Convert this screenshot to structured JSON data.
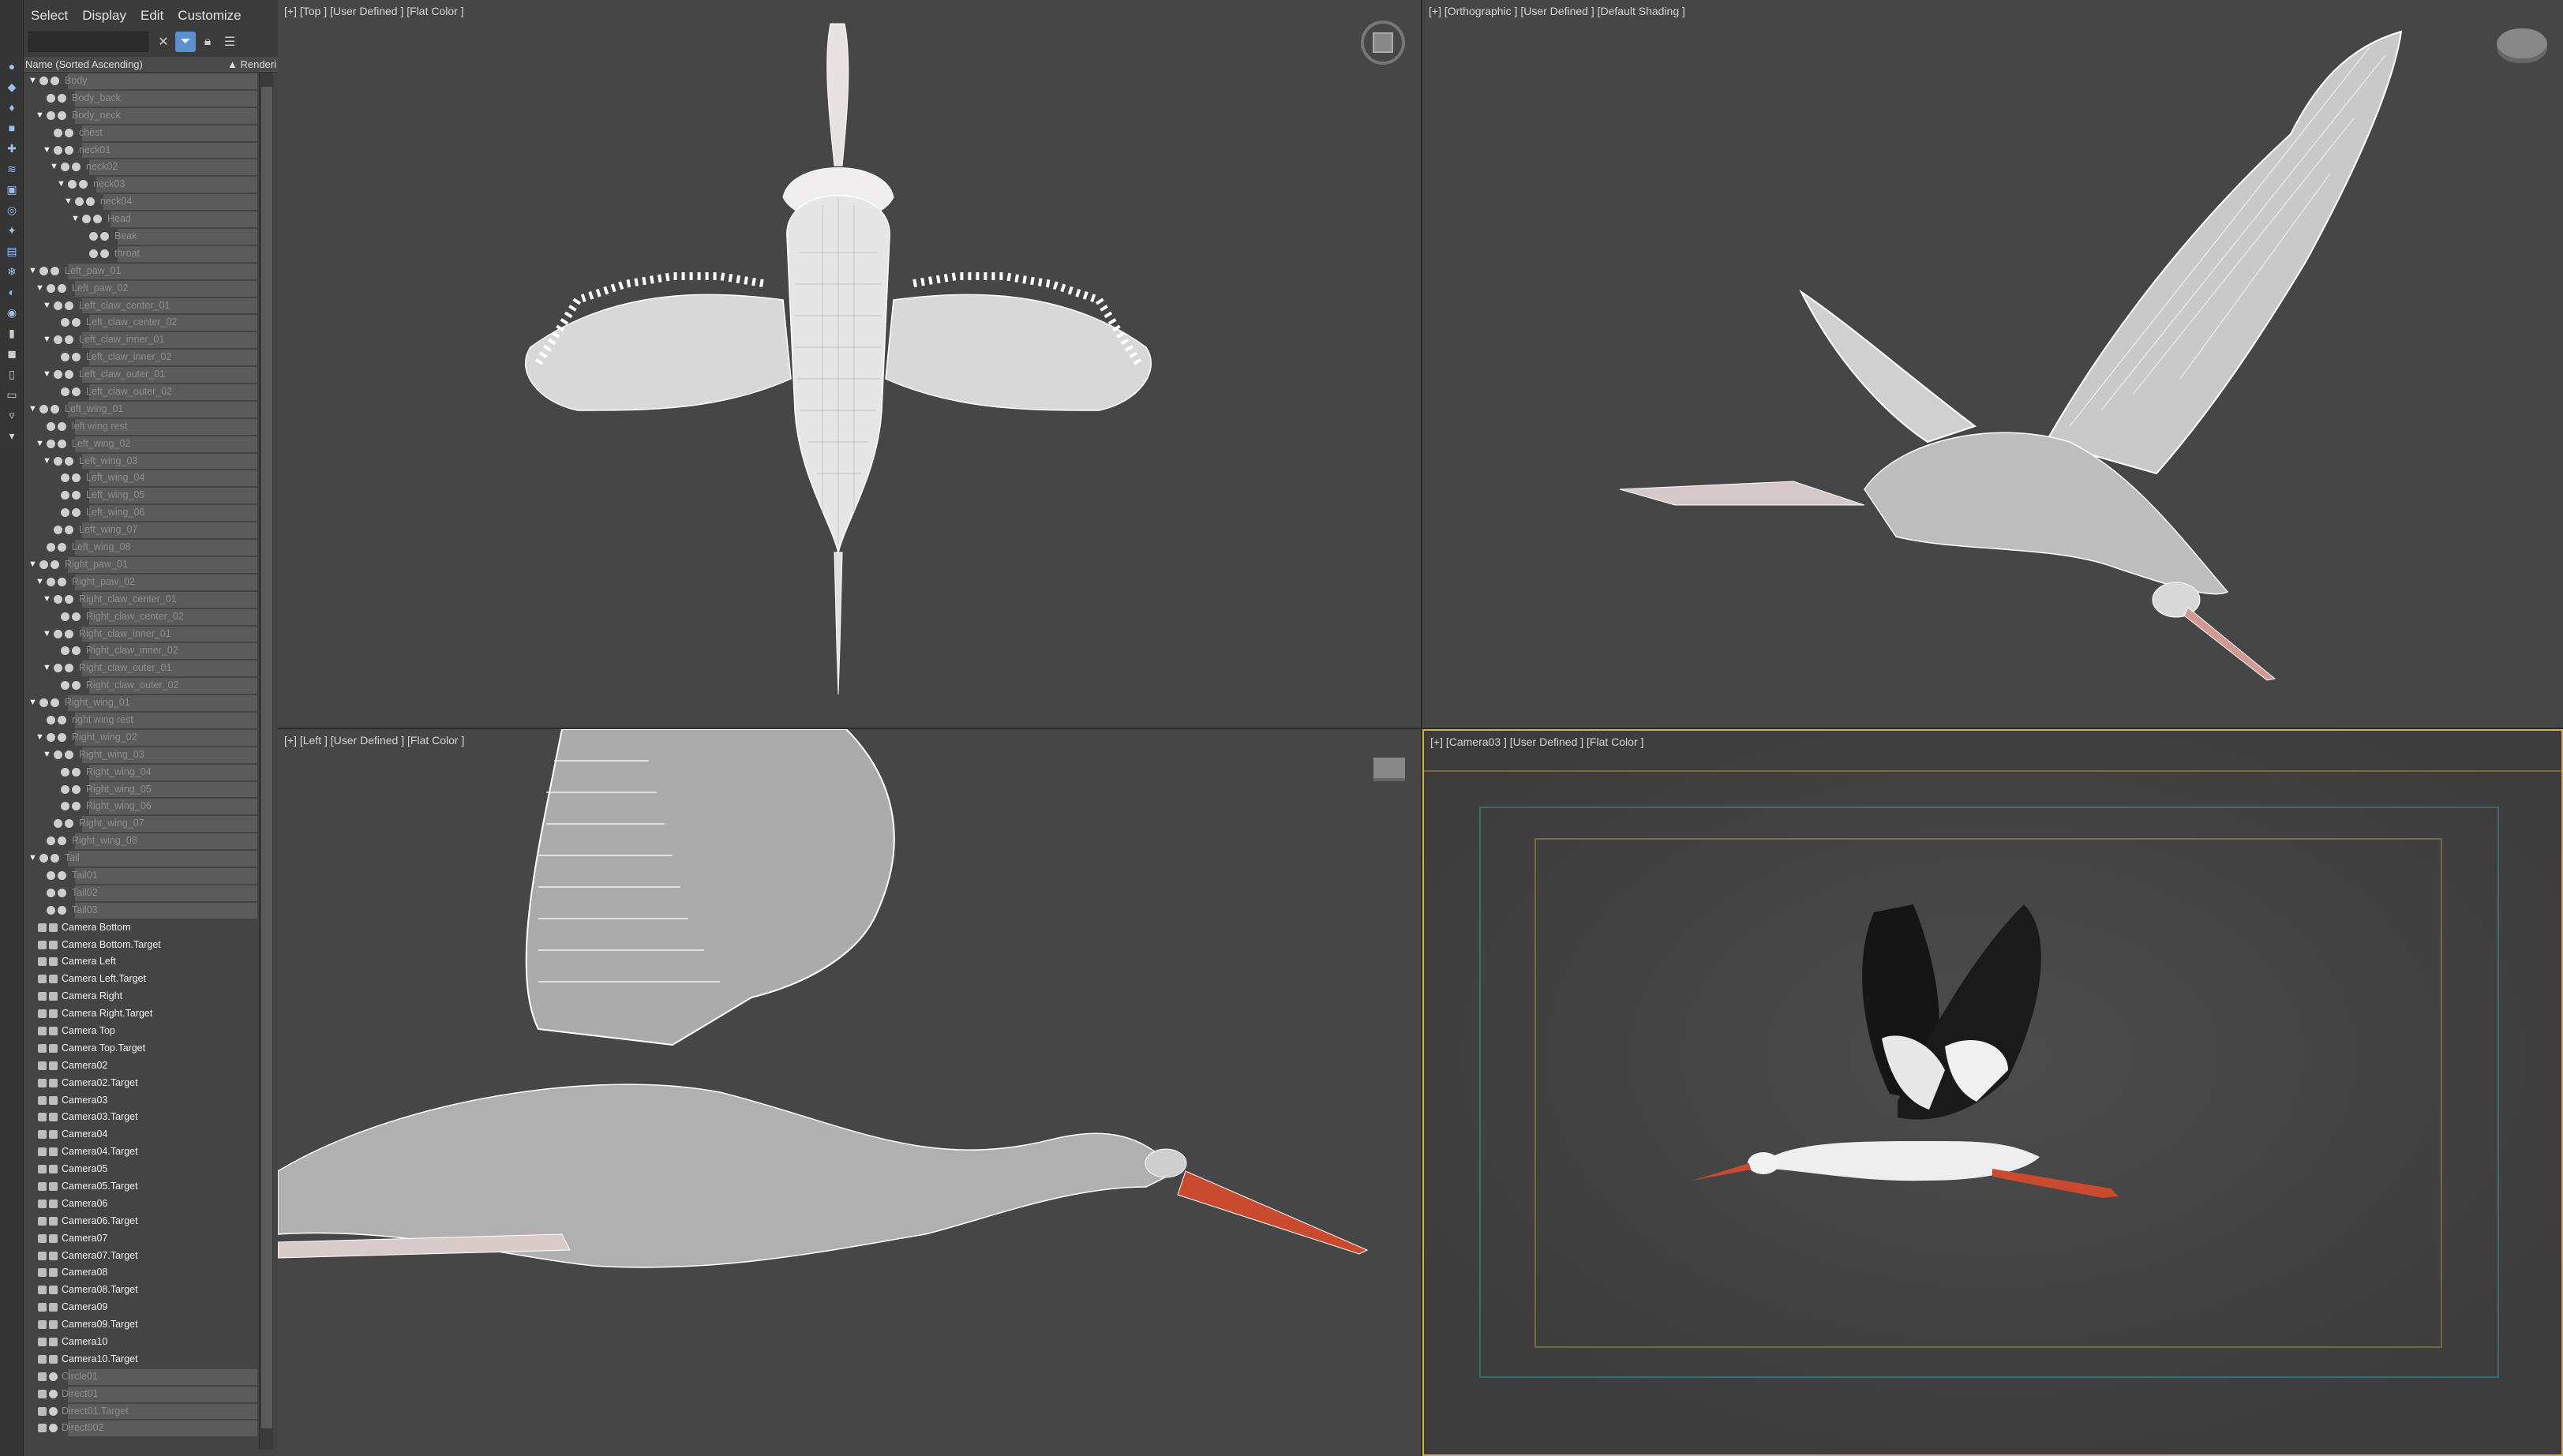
{
  "menu": [
    "Select",
    "Display",
    "Edit",
    "Customize"
  ],
  "explorer": {
    "search_value": "",
    "column_name": "Name (Sorted Ascending)",
    "column_render": "▲ Renderi",
    "rows": [
      {
        "t": "Body",
        "d": 0,
        "a": 1,
        "s": "dim"
      },
      {
        "t": "Body_back",
        "d": 1,
        "a": 0,
        "s": "dim"
      },
      {
        "t": "Body_neck",
        "d": 1,
        "a": 1,
        "s": "dim"
      },
      {
        "t": "chest",
        "d": 2,
        "a": 0,
        "s": "dim"
      },
      {
        "t": "neck01",
        "d": 2,
        "a": 1,
        "s": "dim"
      },
      {
        "t": "neck02",
        "d": 3,
        "a": 1,
        "s": "dim"
      },
      {
        "t": "neck03",
        "d": 4,
        "a": 1,
        "s": "dim"
      },
      {
        "t": "neck04",
        "d": 5,
        "a": 1,
        "s": "dim"
      },
      {
        "t": "Head",
        "d": 6,
        "a": 1,
        "s": "dim"
      },
      {
        "t": "Beak",
        "d": 7,
        "a": 0,
        "s": "dim"
      },
      {
        "t": "throat",
        "d": 7,
        "a": 0,
        "s": "dim"
      },
      {
        "t": "Left_paw_01",
        "d": 0,
        "a": 1,
        "s": "dim"
      },
      {
        "t": "Left_paw_02",
        "d": 1,
        "a": 1,
        "s": "dim"
      },
      {
        "t": "Left_claw_center_01",
        "d": 2,
        "a": 1,
        "s": "dim"
      },
      {
        "t": "Left_claw_center_02",
        "d": 3,
        "a": 0,
        "s": "dim"
      },
      {
        "t": "Left_claw_inner_01",
        "d": 2,
        "a": 1,
        "s": "dim"
      },
      {
        "t": "Left_claw_inner_02",
        "d": 3,
        "a": 0,
        "s": "dim"
      },
      {
        "t": "Left_claw_outer_01",
        "d": 2,
        "a": 1,
        "s": "dim"
      },
      {
        "t": "Left_claw_outer_02",
        "d": 3,
        "a": 0,
        "s": "dim"
      },
      {
        "t": "Left_wing_01",
        "d": 0,
        "a": 1,
        "s": "dim"
      },
      {
        "t": "left wing rest",
        "d": 1,
        "a": 0,
        "s": "dim"
      },
      {
        "t": "Left_wing_02",
        "d": 1,
        "a": 1,
        "s": "dim"
      },
      {
        "t": "Left_wing_03",
        "d": 2,
        "a": 1,
        "s": "dim"
      },
      {
        "t": "Left_wing_04",
        "d": 3,
        "a": 0,
        "s": "dim"
      },
      {
        "t": "Left_wing_05",
        "d": 3,
        "a": 0,
        "s": "dim"
      },
      {
        "t": "Left_wing_06",
        "d": 3,
        "a": 0,
        "s": "dim"
      },
      {
        "t": "Left_wing_07",
        "d": 2,
        "a": 0,
        "s": "dim"
      },
      {
        "t": "Left_wing_08",
        "d": 1,
        "a": 0,
        "s": "dim"
      },
      {
        "t": "Right_paw_01",
        "d": 0,
        "a": 1,
        "s": "dim"
      },
      {
        "t": "Right_paw_02",
        "d": 1,
        "a": 1,
        "s": "dim"
      },
      {
        "t": "Right_claw_center_01",
        "d": 2,
        "a": 1,
        "s": "dim"
      },
      {
        "t": "Right_claw_center_02",
        "d": 3,
        "a": 0,
        "s": "dim"
      },
      {
        "t": "Right_claw_inner_01",
        "d": 2,
        "a": 1,
        "s": "dim"
      },
      {
        "t": "Right_claw_inner_02",
        "d": 3,
        "a": 0,
        "s": "dim"
      },
      {
        "t": "Right_claw_outer_01",
        "d": 2,
        "a": 1,
        "s": "dim"
      },
      {
        "t": "Right_claw_outer_02",
        "d": 3,
        "a": 0,
        "s": "dim"
      },
      {
        "t": "Right_wing_01",
        "d": 0,
        "a": 1,
        "s": "dim"
      },
      {
        "t": "right wing rest",
        "d": 1,
        "a": 0,
        "s": "dim"
      },
      {
        "t": "Right_wing_02",
        "d": 1,
        "a": 1,
        "s": "dim"
      },
      {
        "t": "Right_wing_03",
        "d": 2,
        "a": 1,
        "s": "dim"
      },
      {
        "t": "Right_wing_04",
        "d": 3,
        "a": 0,
        "s": "dim"
      },
      {
        "t": "Right_wing_05",
        "d": 3,
        "a": 0,
        "s": "dim"
      },
      {
        "t": "Right_wing_06",
        "d": 3,
        "a": 0,
        "s": "dim"
      },
      {
        "t": "Right_wing_07",
        "d": 2,
        "a": 0,
        "s": "dim"
      },
      {
        "t": "Right_wing_08",
        "d": 1,
        "a": 0,
        "s": "dim"
      },
      {
        "t": "Tail",
        "d": 0,
        "a": 1,
        "s": "dim"
      },
      {
        "t": "Tail01",
        "d": 1,
        "a": 0,
        "s": "dim"
      },
      {
        "t": "Tail02",
        "d": 1,
        "a": 0,
        "s": "dim"
      },
      {
        "t": "Tail03",
        "d": 1,
        "a": 0,
        "s": "dim"
      },
      {
        "t": "Camera Bottom",
        "d": 0,
        "a": 0,
        "s": "bright",
        "c": 1
      },
      {
        "t": "Camera Bottom.Target",
        "d": 0,
        "a": 0,
        "s": "bright",
        "c": 1
      },
      {
        "t": "Camera Left",
        "d": 0,
        "a": 0,
        "s": "bright",
        "c": 1
      },
      {
        "t": "Camera Left.Target",
        "d": 0,
        "a": 0,
        "s": "bright",
        "c": 1
      },
      {
        "t": "Camera Right",
        "d": 0,
        "a": 0,
        "s": "bright",
        "c": 1
      },
      {
        "t": "Camera Right.Target",
        "d": 0,
        "a": 0,
        "s": "bright",
        "c": 1
      },
      {
        "t": "Camera Top",
        "d": 0,
        "a": 0,
        "s": "bright",
        "c": 1
      },
      {
        "t": "Camera Top.Target",
        "d": 0,
        "a": 0,
        "s": "bright",
        "c": 1
      },
      {
        "t": "Camera02",
        "d": 0,
        "a": 0,
        "s": "bright",
        "c": 1
      },
      {
        "t": "Camera02.Target",
        "d": 0,
        "a": 0,
        "s": "bright",
        "c": 1
      },
      {
        "t": "Camera03",
        "d": 0,
        "a": 0,
        "s": "bright",
        "c": 1
      },
      {
        "t": "Camera03.Target",
        "d": 0,
        "a": 0,
        "s": "bright",
        "c": 1
      },
      {
        "t": "Camera04",
        "d": 0,
        "a": 0,
        "s": "bright",
        "c": 1
      },
      {
        "t": "Camera04.Target",
        "d": 0,
        "a": 0,
        "s": "bright",
        "c": 1
      },
      {
        "t": "Camera05",
        "d": 0,
        "a": 0,
        "s": "bright",
        "c": 1
      },
      {
        "t": "Camera05.Target",
        "d": 0,
        "a": 0,
        "s": "bright",
        "c": 1
      },
      {
        "t": "Camera06",
        "d": 0,
        "a": 0,
        "s": "bright",
        "c": 1
      },
      {
        "t": "Camera06.Target",
        "d": 0,
        "a": 0,
        "s": "bright",
        "c": 1
      },
      {
        "t": "Camera07",
        "d": 0,
        "a": 0,
        "s": "bright",
        "c": 1
      },
      {
        "t": "Camera07.Target",
        "d": 0,
        "a": 0,
        "s": "bright",
        "c": 1
      },
      {
        "t": "Camera08",
        "d": 0,
        "a": 0,
        "s": "bright",
        "c": 1
      },
      {
        "t": "Camera08.Target",
        "d": 0,
        "a": 0,
        "s": "bright",
        "c": 1
      },
      {
        "t": "Camera09",
        "d": 0,
        "a": 0,
        "s": "bright",
        "c": 1
      },
      {
        "t": "Camera09.Target",
        "d": 0,
        "a": 0,
        "s": "bright",
        "c": 1
      },
      {
        "t": "Camera10",
        "d": 0,
        "a": 0,
        "s": "bright",
        "c": 1
      },
      {
        "t": "Camera10.Target",
        "d": 0,
        "a": 0,
        "s": "bright",
        "c": 1
      },
      {
        "t": "Circle01",
        "d": 0,
        "a": 0,
        "s": "dim",
        "c": 2
      },
      {
        "t": "Direct01",
        "d": 0,
        "a": 0,
        "s": "dim",
        "c": 3
      },
      {
        "t": "Direct01.Target",
        "d": 0,
        "a": 0,
        "s": "dim",
        "c": 3
      },
      {
        "t": "Direct002",
        "d": 0,
        "a": 0,
        "s": "dim",
        "c": 3
      }
    ]
  },
  "viewports": {
    "top_label": "[+] [Top ] [User Defined ] [Flat Color ]",
    "persp_label": "[+] [Orthographic ] [User Defined ] [Default Shading ]",
    "left_label": "[+] [Left ] [User Defined ] [Flat Color ]",
    "cam_label": "[+] [Camera03 ] [User Defined ] [Flat Color ]"
  },
  "icons": [
    "view-cube-icon",
    "close-icon",
    "filter-icon",
    "lock-icon",
    "hierarchy-icon"
  ],
  "colors": {
    "accent": "#5a8fd0",
    "safe_frame_yellow": "#c9b24a",
    "safe_frame_cyan": "#3fb8b8",
    "beak": "#c94a2e"
  }
}
